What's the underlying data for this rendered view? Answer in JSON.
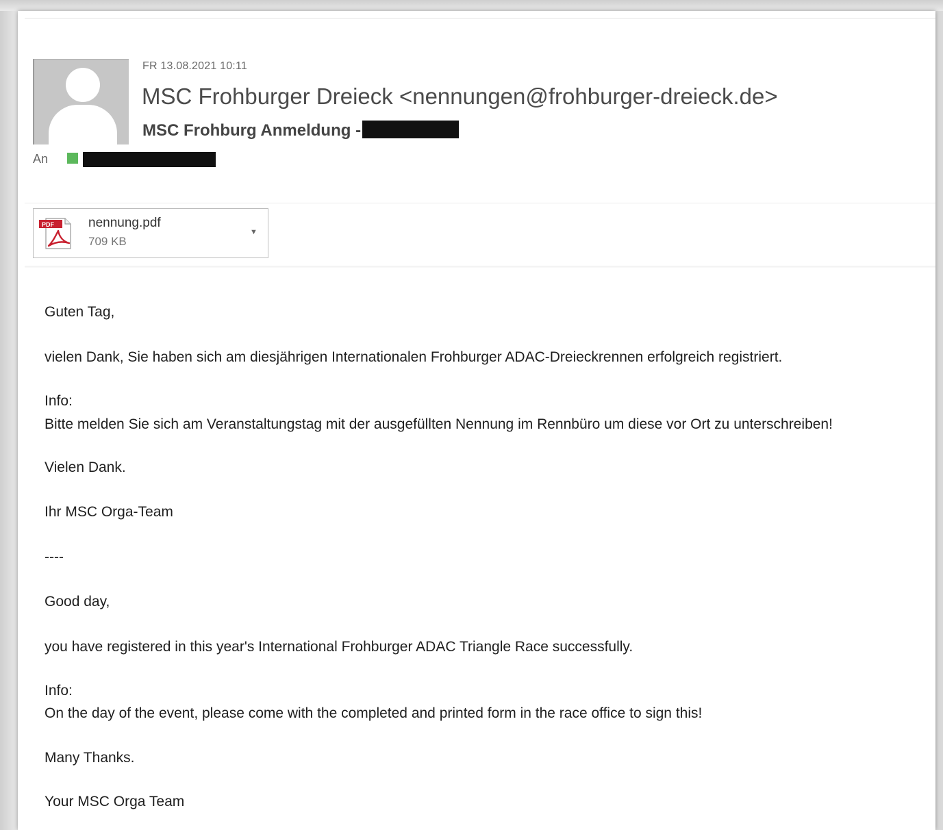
{
  "message": {
    "date": "FR 13.08.2021 10:11",
    "from": "MSC Frohburger Dreieck <nennungen@frohburger-dreieck.de>",
    "subject": "MSC Frohburg Anmeldung -",
    "to_label": "An"
  },
  "attachment": {
    "icon_label": "PDF",
    "name": "nennung.pdf",
    "size": "709 KB"
  },
  "body": {
    "lines": [
      "Guten Tag,",
      "vielen Dank, Sie haben sich am diesjährigen Internationalen Frohburger ADAC-Dreieckrennen erfolgreich registriert.",
      "Info:",
      "Bitte melden Sie sich am Veranstaltungstag mit der ausgefüllten Nennung im Rennbüro um diese vor Ort zu unterschreiben!",
      "Vielen Dank.",
      "Ihr MSC Orga-Team",
      "----",
      "Good day,",
      "you have registered in this year's International Frohburger ADAC Triangle Race successfully.",
      "Info:",
      "On the day of the event, please come with the completed and printed form in the race office to sign this!",
      "Many Thanks.",
      "Your MSC Orga Team"
    ]
  },
  "colors": {
    "presence": "#5cb85c",
    "pdf_red": "#c8202f",
    "redaction": "#111111"
  }
}
